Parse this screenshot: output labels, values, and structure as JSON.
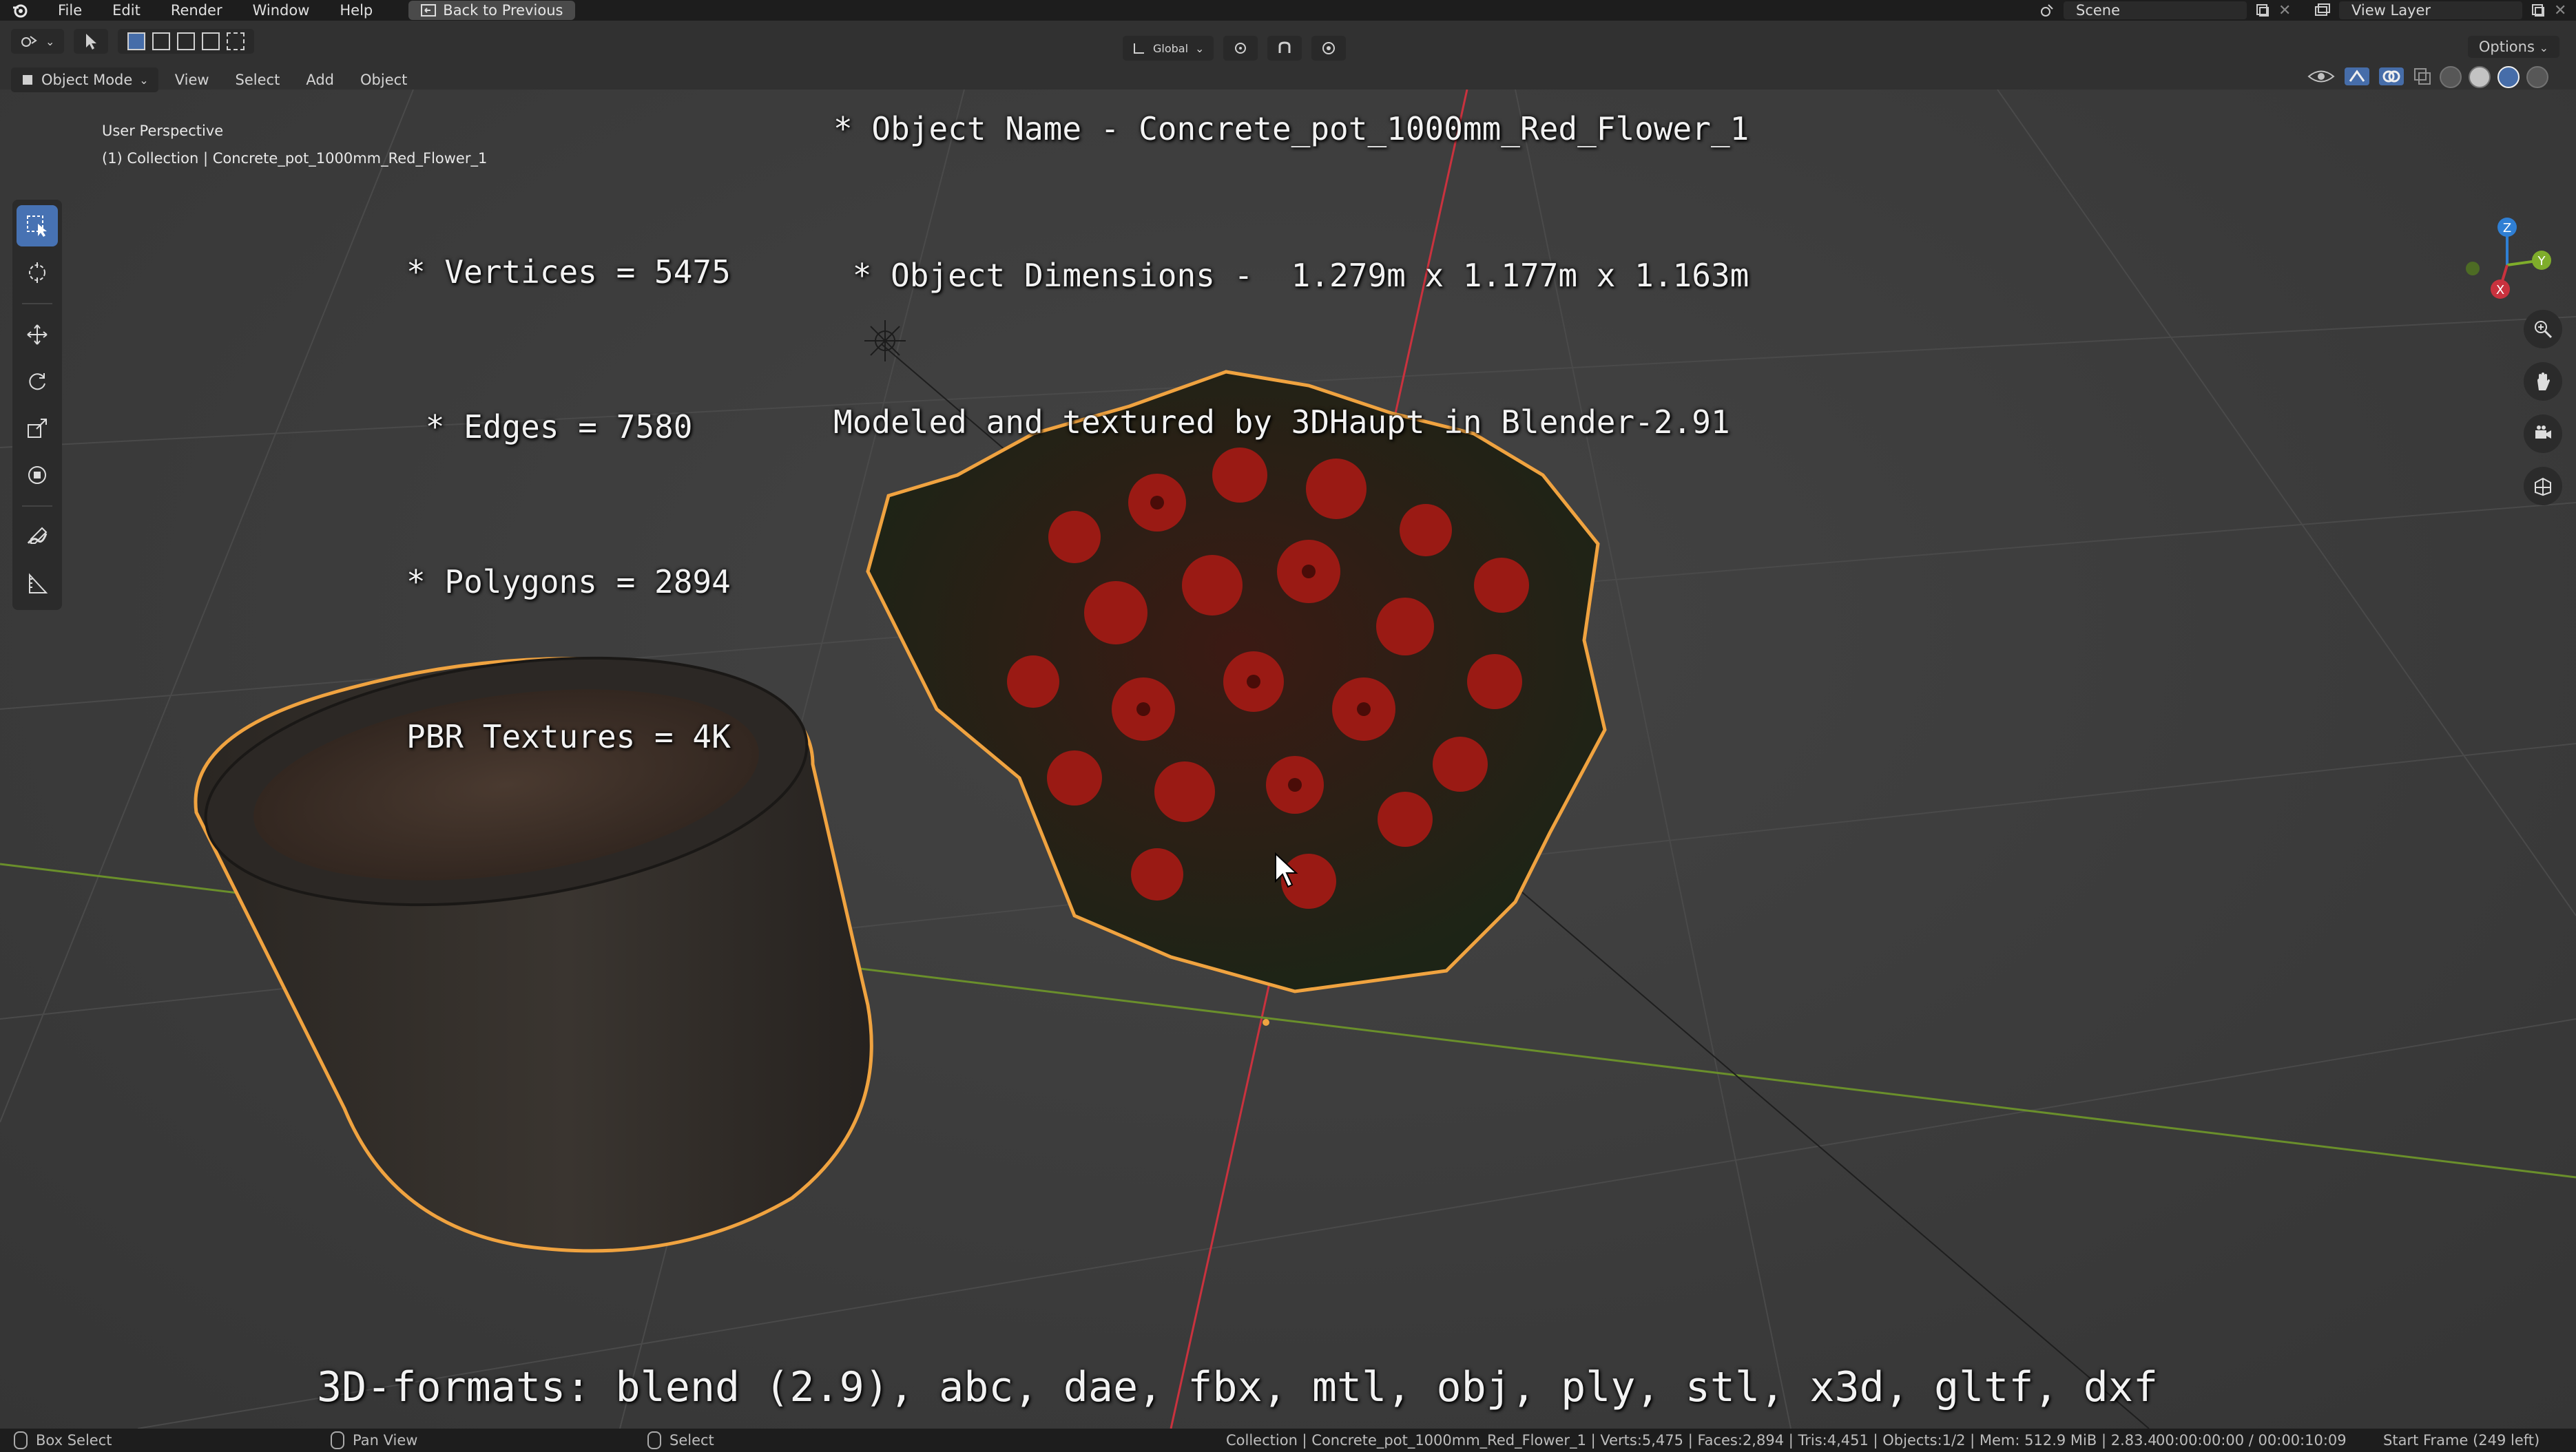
{
  "topbar": {
    "menus": [
      "File",
      "Edit",
      "Render",
      "Window",
      "Help"
    ],
    "back_button": "Back to Previous",
    "scene_label": "Scene",
    "view_layer_label": "View Layer"
  },
  "viewport_header": {
    "mode": "Object Mode",
    "menus": [
      "View",
      "Select",
      "Add",
      "Object"
    ],
    "transform_orientation": "Global",
    "options_label": "Options"
  },
  "viewport_info": {
    "perspective": "User Perspective",
    "collection": "(1) Collection | Concrete_pot_1000mm_Red_Flower_1"
  },
  "overlay": {
    "stats": [
      "* Vertices = 5475",
      " * Edges = 7580",
      "* Polygons = 2894",
      "PBR Textures = 4K"
    ],
    "object_lines": [
      "* Object Name - Concrete_pot_1000mm_Red_Flower_1",
      " * Object Dimensions -  1.279m x 1.177m x 1.163m",
      "Modeled and textured by 3DHaupt in Blender-2.91"
    ],
    "formats": "3D-formats: blend (2.9), abc, dae, fbx, mtl, obj, ply, stl, x3d, gltf, dxf"
  },
  "statusbar": {
    "box_select": "Box Select",
    "pan_view": "Pan View",
    "select": "Select",
    "stats": "Collection | Concrete_pot_1000mm_Red_Flower_1 | Verts:5,475 | Faces:2,894 | Tris:4,451 | Objects:1/2 | Mem: 512.9 MiB | 2.83.4",
    "time": "00:00:00:00 / 00:00:10:09",
    "start_frame": "Start Frame (249 left)"
  },
  "gizmo": {
    "x": "X",
    "y": "Y",
    "z": "Z"
  },
  "colors": {
    "accent": "#4772b3",
    "selection": "#f0a340",
    "x_axis": "#c9323e",
    "y_axis": "#7fad2b",
    "z_axis": "#2f7fd4"
  },
  "icons": [
    "blender-logo",
    "select-box",
    "cursor",
    "move",
    "rotate",
    "scale",
    "transform",
    "annotate",
    "measure",
    "zoom",
    "pan-hand",
    "camera",
    "grid"
  ]
}
